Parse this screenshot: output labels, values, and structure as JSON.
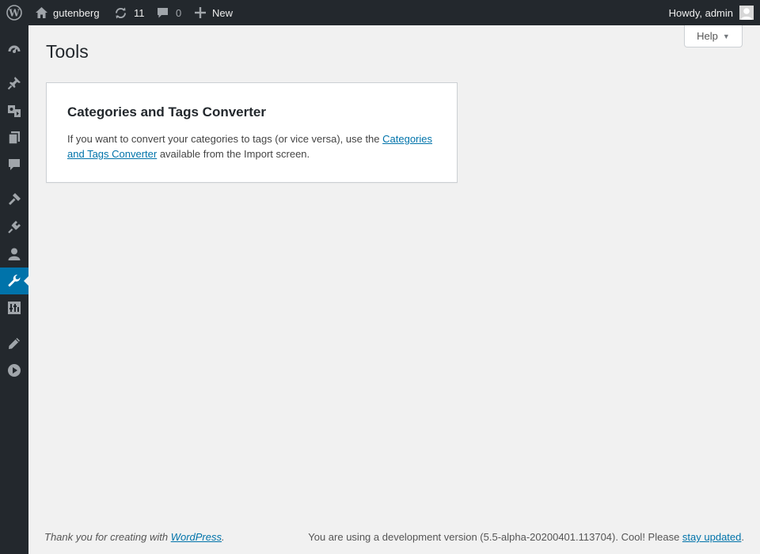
{
  "admin_bar": {
    "site_name": "gutenberg",
    "updates_count": "11",
    "comments_count": "0",
    "new_label": "New",
    "account_greeting": "Howdy, admin"
  },
  "sidebar": {
    "items": [
      {
        "icon": "dashboard-icon"
      },
      {
        "icon": "posts-pin-icon"
      },
      {
        "icon": "media-icon"
      },
      {
        "icon": "pages-icon"
      },
      {
        "icon": "comments-icon"
      },
      {
        "icon": "appearance-icon"
      },
      {
        "icon": "plugins-icon"
      },
      {
        "icon": "users-icon"
      },
      {
        "icon": "tools-wrench-icon",
        "current": true
      },
      {
        "icon": "settings-icon"
      },
      {
        "icon": "edit-pencil-icon"
      },
      {
        "icon": "play-circle-icon"
      }
    ],
    "active_color": "#0073aa"
  },
  "page": {
    "title": "Tools",
    "help_label": "Help"
  },
  "card": {
    "title": "Categories and Tags Converter",
    "text_before": "If you want to convert your categories to tags (or vice versa), use the ",
    "link_text": "Categories and Tags Converter",
    "text_after": " available from the Import screen."
  },
  "footer": {
    "thanks_prefix": "Thank you for creating with ",
    "thanks_link": "WordPress",
    "thanks_suffix": ".",
    "version_prefix": "You are using a development version (5.5-alpha-20200401.113704). Cool! Please ",
    "version_link": "stay updated",
    "version_suffix": "."
  },
  "colors": {
    "admin_bar_bg": "#23282d",
    "link": "#0073aa",
    "page_bg": "#f1f1f1"
  }
}
